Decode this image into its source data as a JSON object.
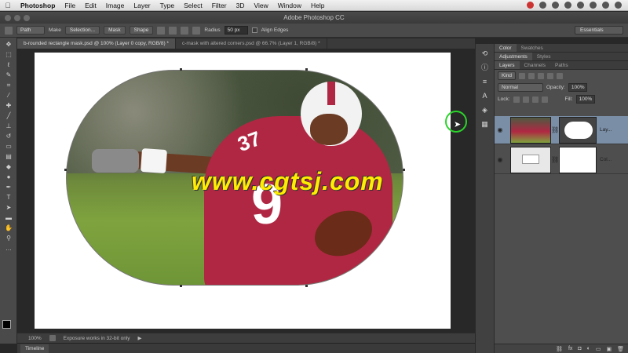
{
  "menubar": {
    "apple": "",
    "items": [
      "Photoshop",
      "File",
      "Edit",
      "Image",
      "Layer",
      "Type",
      "Select",
      "Filter",
      "3D",
      "View",
      "Window",
      "Help"
    ]
  },
  "window": {
    "title": "Adobe Photoshop CC"
  },
  "options": {
    "mode": "Path",
    "make_label": "Make",
    "selection_btn": "Selection...",
    "mask_btn": "Mask",
    "shape_btn": "Shape",
    "radius_label": "Radius",
    "radius_value": "50 px",
    "align_edges": "Align Edges",
    "workspace": "Essentials"
  },
  "tabs": [
    {
      "label": "b-rounded rectangle mask.psd @ 100% (Layer 0 copy, RGB/8) *",
      "active": true
    },
    {
      "label": "c-mask with altered corners.psd @ 66.7% (Layer 1, RGB/8) *",
      "active": false
    }
  ],
  "canvas": {
    "jersey_number_big": "9",
    "jersey_number_small": "37",
    "watermark": "www.cgtsj.com"
  },
  "status": {
    "zoom": "100%",
    "message": "Exposure works in 32-bit only"
  },
  "timeline": {
    "label": "Timeline"
  },
  "panels": {
    "top_tabs": [
      "Color",
      "Swatches"
    ],
    "mid_tabs": [
      "Adjustments",
      "Styles"
    ],
    "layer_tabs": [
      "Layers",
      "Channels",
      "Paths"
    ],
    "kind": "Kind",
    "blend_mode": "Normal",
    "opacity_label": "Opacity:",
    "opacity_value": "100%",
    "lock_label": "Lock:",
    "fill_label": "Fill:",
    "fill_value": "100%",
    "layers": [
      {
        "name": "Lay...",
        "selected": true
      },
      {
        "name": "Col...",
        "selected": false
      }
    ]
  },
  "colors": {
    "accent_selected": "#7a8ea6",
    "cursor_ring": "#2bd42b",
    "watermark": "#ffec00"
  }
}
